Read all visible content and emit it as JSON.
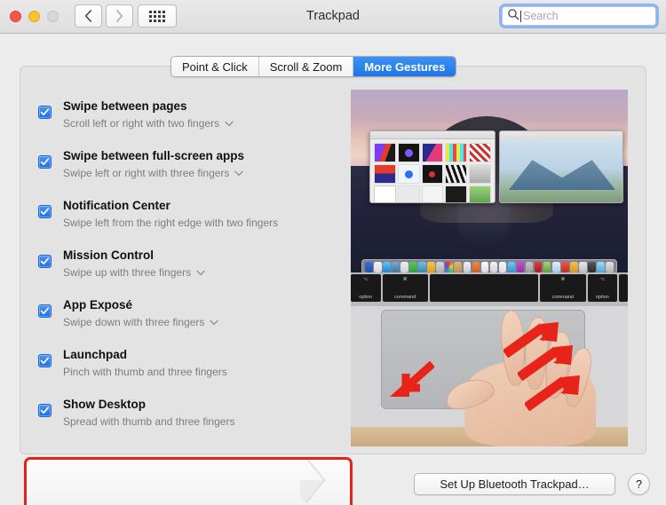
{
  "window": {
    "title": "Trackpad",
    "traffic_lights": [
      "close-red",
      "minimize-yellow",
      "zoom-green-disabled"
    ],
    "back_label": "‹",
    "forward_label": "›",
    "show_all_label": "show-all-grid"
  },
  "search": {
    "placeholder": "Search",
    "value": "",
    "focus_ring_color": "#8ab4f8"
  },
  "tabs": [
    {
      "label": "Point & Click",
      "active": false
    },
    {
      "label": "Scroll & Zoom",
      "active": false
    },
    {
      "label": "More Gestures",
      "active": true
    }
  ],
  "accent_color": "#1f74e8",
  "highlight_color": "#e2231a",
  "gestures": [
    {
      "title": "Swipe between pages",
      "subtitle": "Scroll left or right with two fingers",
      "checked": true,
      "has_dropdown": true,
      "highlighted": false
    },
    {
      "title": "Swipe between full-screen apps",
      "subtitle": "Swipe left or right with three fingers",
      "checked": true,
      "has_dropdown": true,
      "highlighted": false
    },
    {
      "title": "Notification Center",
      "subtitle": "Swipe left from the right edge with two fingers",
      "checked": true,
      "has_dropdown": false,
      "highlighted": false
    },
    {
      "title": "Mission Control",
      "subtitle": "Swipe up with three fingers",
      "checked": true,
      "has_dropdown": true,
      "highlighted": false
    },
    {
      "title": "App Exposé",
      "subtitle": "Swipe down with three fingers",
      "checked": true,
      "has_dropdown": true,
      "highlighted": false
    },
    {
      "title": "Launchpad",
      "subtitle": "Pinch with thumb and three fingers",
      "checked": true,
      "has_dropdown": false,
      "highlighted": false
    },
    {
      "title": "Show Desktop",
      "subtitle": "Spread with thumb and three fingers",
      "checked": true,
      "has_dropdown": false,
      "highlighted": true
    }
  ],
  "demo": {
    "name": "show-desktop-gesture-demo",
    "keys": [
      "option",
      "command",
      "",
      "command",
      "option",
      ""
    ],
    "key_symbols": [
      "⌥",
      "⌘",
      "",
      "⌘",
      "⌥",
      ""
    ]
  },
  "footer": {
    "bluetooth_button": "Set Up Bluetooth Trackpad…",
    "help_button": "?"
  }
}
